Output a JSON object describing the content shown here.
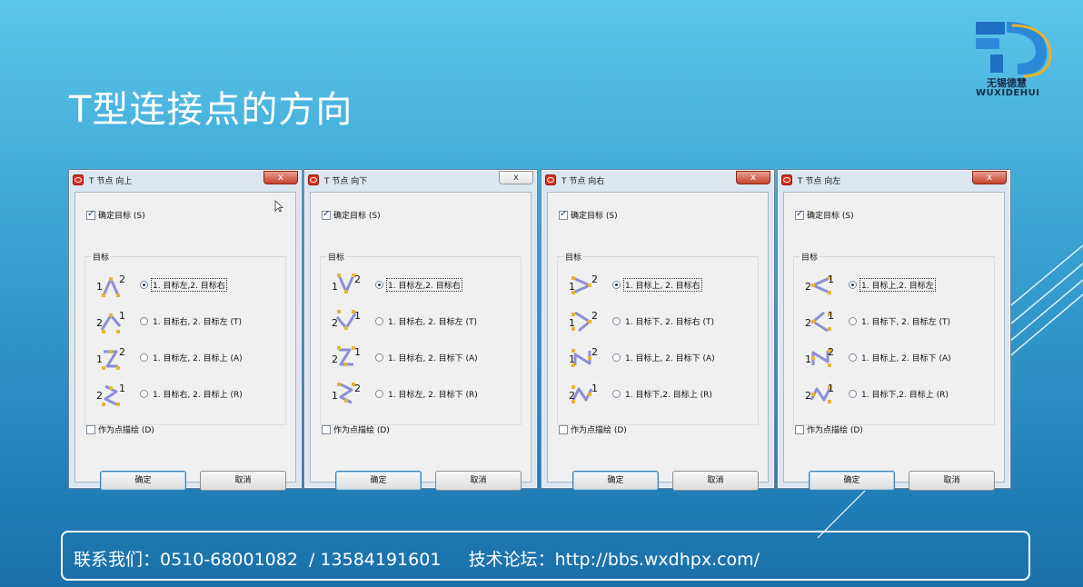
{
  "slide": {
    "title": "T型连接点的方向",
    "logo_cn": "无锡德慧",
    "logo_en": "WUXIDEHUI",
    "footer": "联系我们：0510-68001082  / 13584191601     技术论坛：http://bbs.wxdhpx.com/"
  },
  "colors": {
    "accent_close": "#c7432c",
    "glyph_line": "#8c8fd6",
    "glyph_node": "#e0b83a"
  },
  "dialogs": [
    {
      "title": "T 节点 向上",
      "close": "x",
      "confirm_target": "确定目标 (S)",
      "confirm_checked": true,
      "group": "目标",
      "options": [
        {
          "glyph": [
            "1",
            "2"
          ],
          "label": "1. 目标左,2. 目标右",
          "selected": true
        },
        {
          "glyph": [
            "2",
            "1"
          ],
          "label": "1. 目标右, 2. 目标左 (T)",
          "selected": false
        },
        {
          "glyph": [
            "1",
            "2"
          ],
          "label": "1. 目标左, 2. 目标上 (A)",
          "selected": false
        },
        {
          "glyph": [
            "2",
            "1"
          ],
          "label": "1. 目标右, 2. 目标上 (R)",
          "selected": false
        }
      ],
      "as_point": "作为点描绘 (D)",
      "ok": "确定",
      "cancel": "取消"
    },
    {
      "title": "T 节点 向下",
      "close": "x",
      "confirm_target": "确定目标 (S)",
      "confirm_checked": true,
      "group": "目标",
      "options": [
        {
          "glyph": [
            "1",
            "2"
          ],
          "label": "1. 目标左,2. 目标右",
          "selected": true
        },
        {
          "glyph": [
            "2",
            "1"
          ],
          "label": "1. 目标右, 2. 目标左 (T)",
          "selected": false
        },
        {
          "glyph": [
            "2",
            "1"
          ],
          "label": "1. 目标右, 2. 目标下 (A)",
          "selected": false
        },
        {
          "glyph": [
            "1",
            "2"
          ],
          "label": "1. 目标左, 2. 目标下 (R)",
          "selected": false
        }
      ],
      "as_point": "作为点描绘 (D)",
      "ok": "确定",
      "cancel": "取消"
    },
    {
      "title": "T 节点 向右",
      "close": "x",
      "confirm_target": "确定目标 (S)",
      "confirm_checked": true,
      "group": "目标",
      "options": [
        {
          "glyph": [
            "1",
            "2"
          ],
          "label": "1. 目标上, 2. 目标右",
          "selected": true
        },
        {
          "glyph": [
            "1",
            "2"
          ],
          "label": "1. 目标下, 2. 目标右 (T)",
          "selected": false
        },
        {
          "glyph": [
            "1",
            "2"
          ],
          "label": "1. 目标上, 2. 目标下 (A)",
          "selected": false
        },
        {
          "glyph": [
            "2",
            "1"
          ],
          "label": "1. 目标下,2. 目标上 (R)",
          "selected": false
        }
      ],
      "as_point": "作为点描绘 (D)",
      "ok": "确定",
      "cancel": "取消"
    },
    {
      "title": "T 节点 向左",
      "close": "x",
      "confirm_target": "确定目标 (S)",
      "confirm_checked": true,
      "group": "目标",
      "options": [
        {
          "glyph": [
            "2",
            "1"
          ],
          "label": "1. 目标上,2. 目标左",
          "selected": true
        },
        {
          "glyph": [
            "2",
            "1"
          ],
          "label": "1. 目标下, 2. 目标左 (T)",
          "selected": false
        },
        {
          "glyph": [
            "1",
            "2"
          ],
          "label": "1. 目标上, 2. 目标下 (A)",
          "selected": false
        },
        {
          "glyph": [
            "2",
            "1"
          ],
          "label": "1. 目标下,2. 目标上 (R)",
          "selected": false
        }
      ],
      "as_point": "作为点描绘 (D)",
      "ok": "确定",
      "cancel": "取消"
    }
  ]
}
